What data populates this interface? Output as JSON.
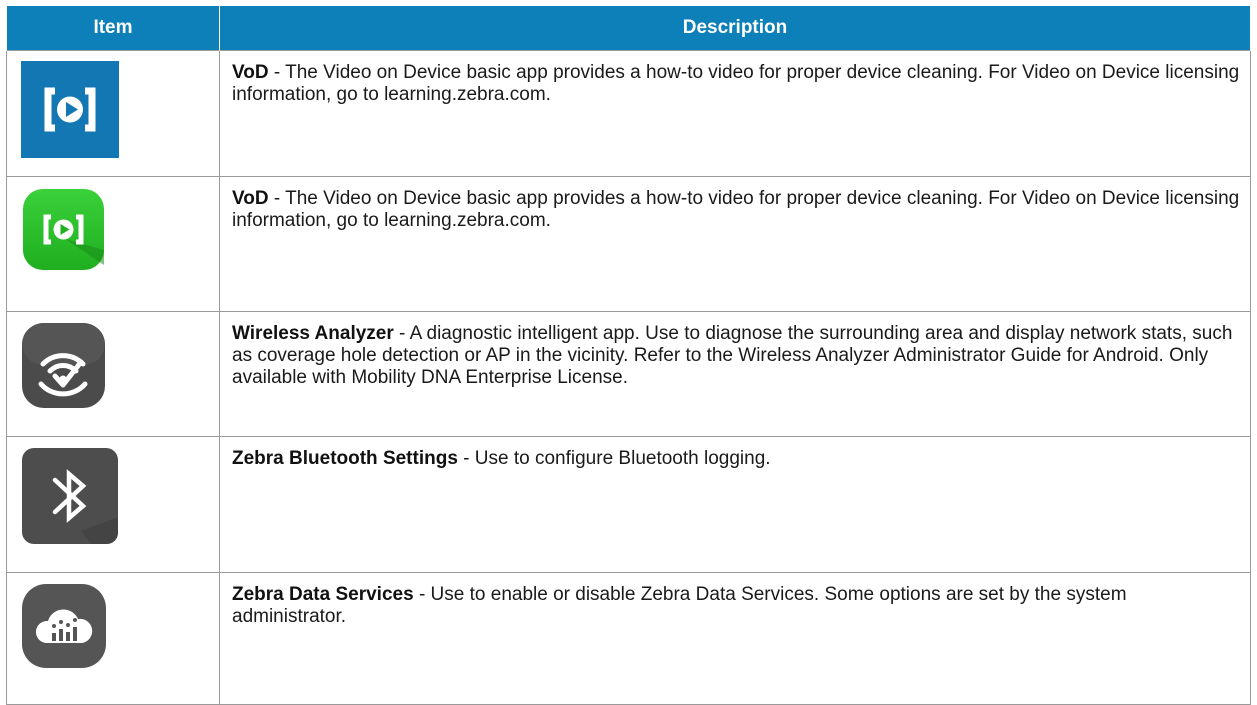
{
  "header": {
    "item": "Item",
    "description": "Description"
  },
  "rows": [
    {
      "icon": "vod-blue-square-icon",
      "name": "VoD",
      "text": " - The Video on Device basic app provides a how-to video for proper device cleaning. For Video on Device licensing information, go to learning.zebra.com."
    },
    {
      "icon": "vod-green-rounded-icon",
      "name": "VoD",
      "text": " - The Video on Device basic app provides a how-to video for proper device cleaning. For Video on Device licensing information, go to learning.zebra.com."
    },
    {
      "icon": "wireless-analyzer-icon",
      "name": "Wireless Analyzer",
      "text": "  - A diagnostic intelligent app. Use to diagnose the surrounding area and display network stats, such as coverage hole detection or AP in the vicinity. Refer to the Wireless Analyzer Administrator Guide for Android. Only available with Mobility DNA Enterprise License."
    },
    {
      "icon": "bluetooth-icon",
      "name": "Zebra Bluetooth Settings",
      "text": " - Use to configure Bluetooth logging."
    },
    {
      "icon": "cloud-data-icon",
      "name": "Zebra Data Services",
      "text": " - Use to enable or disable Zebra Data Services. Some options are set by the system administrator."
    }
  ]
}
